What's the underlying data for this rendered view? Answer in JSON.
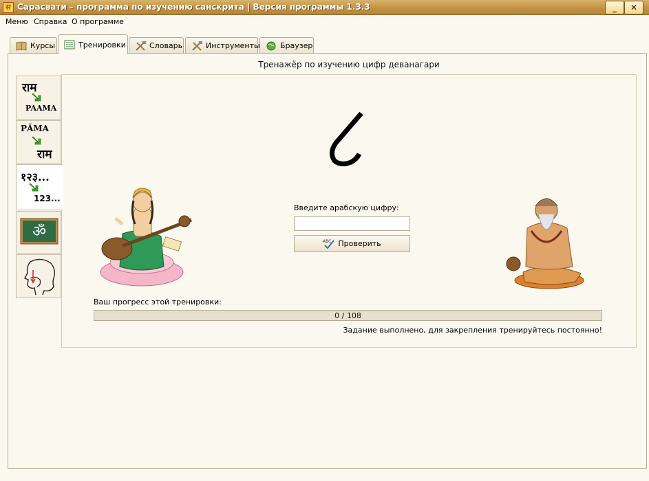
{
  "window": {
    "title": "Сарасвати – программа по изучению санскрита | Версия программы 1.3.3",
    "app_icon_glyph": "स",
    "minimize_glyph": "_",
    "close_glyph": "✕"
  },
  "menu": [
    "Меню",
    "Справка",
    "О программе"
  ],
  "tabs": [
    {
      "label": "Курсы",
      "icon": "book-icon"
    },
    {
      "label": "Тренировки",
      "icon": "list-icon",
      "active": true
    },
    {
      "label": "Словарь",
      "icon": "tools-icon"
    },
    {
      "label": "Инструменты",
      "icon": "tools-icon"
    },
    {
      "label": "Браузер",
      "icon": "globe-icon"
    }
  ],
  "sidebar": {
    "items": [
      {
        "top": "राम",
        "bottom": "PAAMA",
        "icon": "green-arrow-icon"
      },
      {
        "top": "PĀMA",
        "bottom": "राम",
        "icon": "green-arrow-icon"
      },
      {
        "top": "१२३...",
        "bottom": "123...",
        "icon": "green-arrow-icon",
        "active": true
      },
      {
        "glyph": "ॐ",
        "icon": "chalkboard-om-icon"
      },
      {
        "icon": "head-pronunciation-icon"
      }
    ]
  },
  "trainer": {
    "title": "Тренажёр по изучению цифр деванагари",
    "digit_shown": "digit-glyph",
    "input_label": "Введите арабскую цифру:",
    "input_value": "",
    "check_button_label": "Проверить",
    "progress_label": "Ваш прогресс этой тренировки:",
    "progress_text": "0 / 108",
    "progress_fraction": 0,
    "status_text": "Задание выполнено, для закрепления тренируйтесь постоянно!"
  },
  "colors": {
    "titlebar": "#c49244",
    "background": "#fbf8f0",
    "progress_fill": "#79b957",
    "arrow_green": "#3fae2a"
  }
}
